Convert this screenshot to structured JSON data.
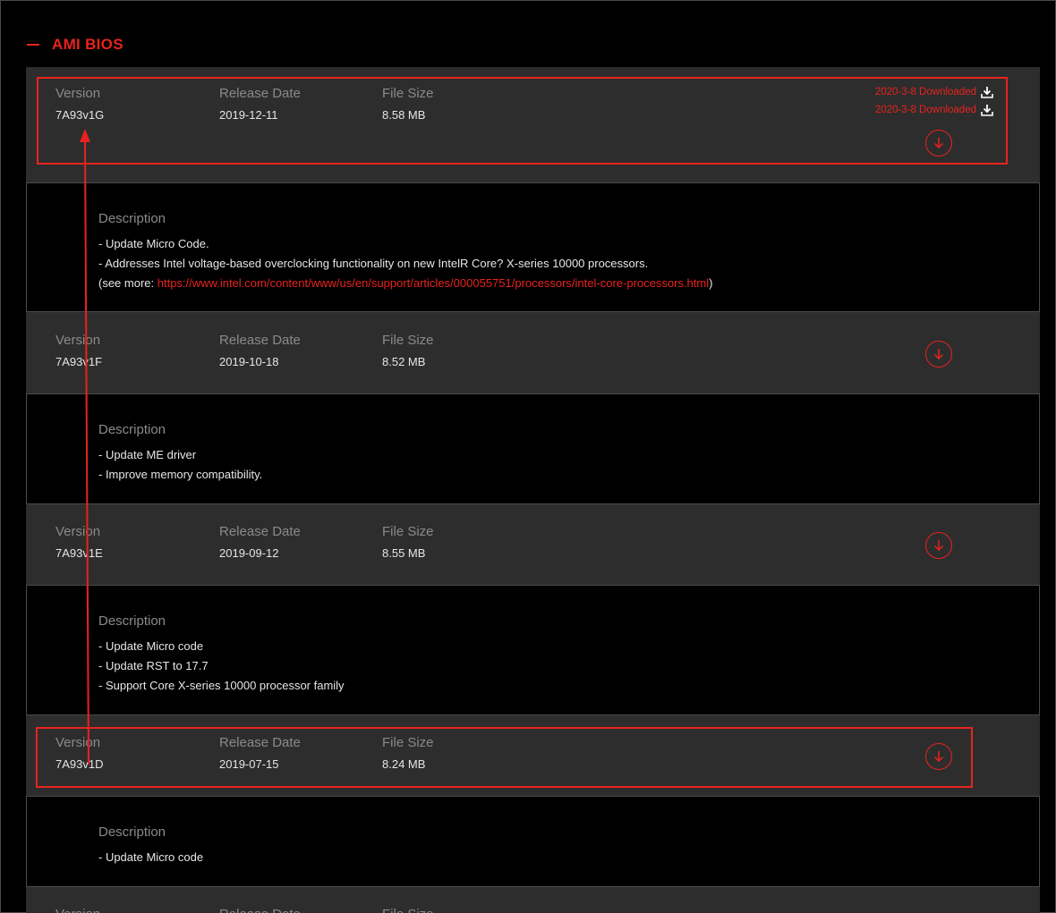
{
  "section": {
    "title": "AMI BIOS"
  },
  "labels": {
    "version": "Version",
    "release_date": "Release Date",
    "file_size": "File Size",
    "description": "Description"
  },
  "download_history": [
    {
      "text": "2020-3-8 Downloaded"
    },
    {
      "text": "2020-3-8 Downloaded"
    }
  ],
  "entries": [
    {
      "version": "7A93v1G",
      "date": "2019-12-11",
      "size": "8.58 MB",
      "desc": [
        "- Update Micro Code.",
        "- Addresses Intel voltage-based overclocking functionality on new IntelR Core? X-series 10000 processors."
      ],
      "see_more_prefix": "(see more: ",
      "see_more_link": "https://www.intel.com/content/www/us/en/support/articles/000055751/processors/intel-core-processors.html",
      "see_more_suffix": ")"
    },
    {
      "version": "7A93v1F",
      "date": "2019-10-18",
      "size": "8.52 MB",
      "desc": [
        "- Update ME driver",
        "- Improve memory compatibility."
      ]
    },
    {
      "version": "7A93v1E",
      "date": "2019-09-12",
      "size": "8.55 MB",
      "desc": [
        "- Update Micro code",
        "- Update RST to 17.7",
        "- Support Core X-series 10000 processor family"
      ]
    },
    {
      "version": "7A93v1D",
      "date": "2019-07-15",
      "size": "8.24 MB",
      "desc": [
        "- Update Micro code"
      ]
    }
  ],
  "colors": {
    "accent": "#e8231d",
    "row_bg": "#2d2d2d",
    "desc_bg": "#000000",
    "label": "#8a8a8a",
    "value": "#e6e6e6"
  },
  "icons": {
    "download": "download-circle-icon",
    "history": "download-tray-icon",
    "section": "minus-icon"
  }
}
